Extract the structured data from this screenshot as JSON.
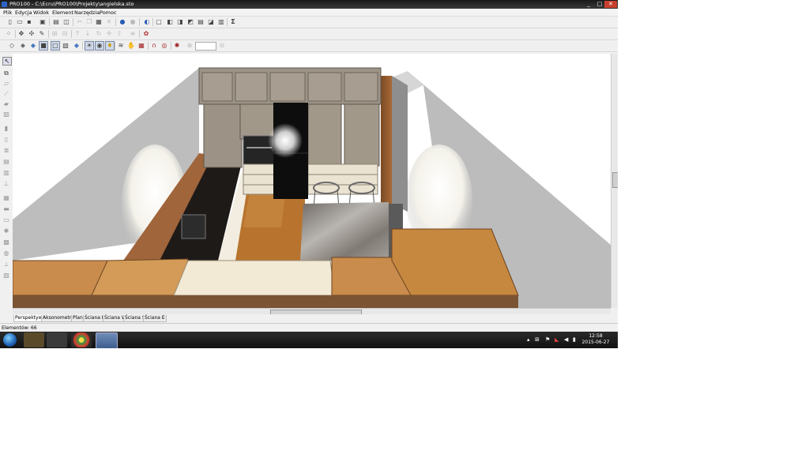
{
  "window": {
    "title": "PRO100 - C:\\Ecru\\PRO100\\Projekty\\angielska.sto",
    "min_icon": "minimize-icon",
    "max_icon": "maximize-icon",
    "close_icon": "close-icon"
  },
  "menu": [
    "Plik",
    "Edycja",
    "Widok",
    "Element",
    "Narzędzia",
    "Pomoc"
  ],
  "toolbar1": {
    "icons": [
      "new-icon",
      "open-icon",
      "save-icon",
      "save-as-icon",
      "print-icon",
      "print-preview-icon",
      "cut-icon",
      "copy-icon",
      "paste-icon",
      "delete-icon",
      "globe-icon",
      "sphere-icon",
      "view-icon",
      "export-icon",
      "import-icon",
      "render-icon",
      "report-icon",
      "quote-icon",
      "sum-icon"
    ],
    "sum_glyph": "Σ"
  },
  "toolbar2": {
    "icons": [
      "grid-icon",
      "align-icon",
      "rotate-icon",
      "pencil-icon",
      "group-icon",
      "ungroup-icon",
      "move-up-icon",
      "move-down-icon",
      "rotate-cw-icon",
      "move-icon",
      "lift-icon",
      "distribute-icon",
      "settings-icon"
    ]
  },
  "toolbar3": {
    "icons": [
      "box-icon",
      "wall-icon",
      "shade-icon",
      "solid-icon",
      "wireframe-icon",
      "textured-icon",
      "transparent-icon",
      "light-icon",
      "camera-icon",
      "hand-icon",
      "lamp-icon",
      "stairs-icon",
      "texture-icon",
      "magnet-icon",
      "target-icon",
      "snap-icon",
      "zoom-icon"
    ],
    "zoom_value": ""
  },
  "left_tools": [
    "select-icon",
    "dimension-icon",
    "box-icon",
    "line-icon",
    "wall-icon",
    "room-icon",
    "door-icon",
    "window-icon",
    "shelf-icon",
    "drawer-icon",
    "handle-icon",
    "leg-icon",
    "panel-icon",
    "plinth-icon",
    "cornice-icon",
    "light-icon",
    "text-icon",
    "label-icon",
    "measure-icon",
    "section-icon",
    "layer-icon",
    "color-icon"
  ],
  "view_tabs": [
    "Perspektywa",
    "Aksonometria",
    "Plan",
    "Ściana N",
    "Ściana W",
    "Ściana S",
    "Ściana E"
  ],
  "active_tab": "Perspektywa",
  "status": "Elementów: 66",
  "taskbar": {
    "items": [
      "explorer-icon",
      "media-player-icon",
      "chrome-icon",
      "pro100-icon"
    ],
    "time": "12:58",
    "date": "2015-06-27"
  },
  "colors": {
    "titlebar": "#1f1f1f",
    "wall": "#bdbdbd",
    "floor": "#b8742e",
    "countertop": "#c98c4c",
    "cabinet": "#9c9386",
    "fridge": "#0d0d0d",
    "island_top": "#8a8580"
  }
}
